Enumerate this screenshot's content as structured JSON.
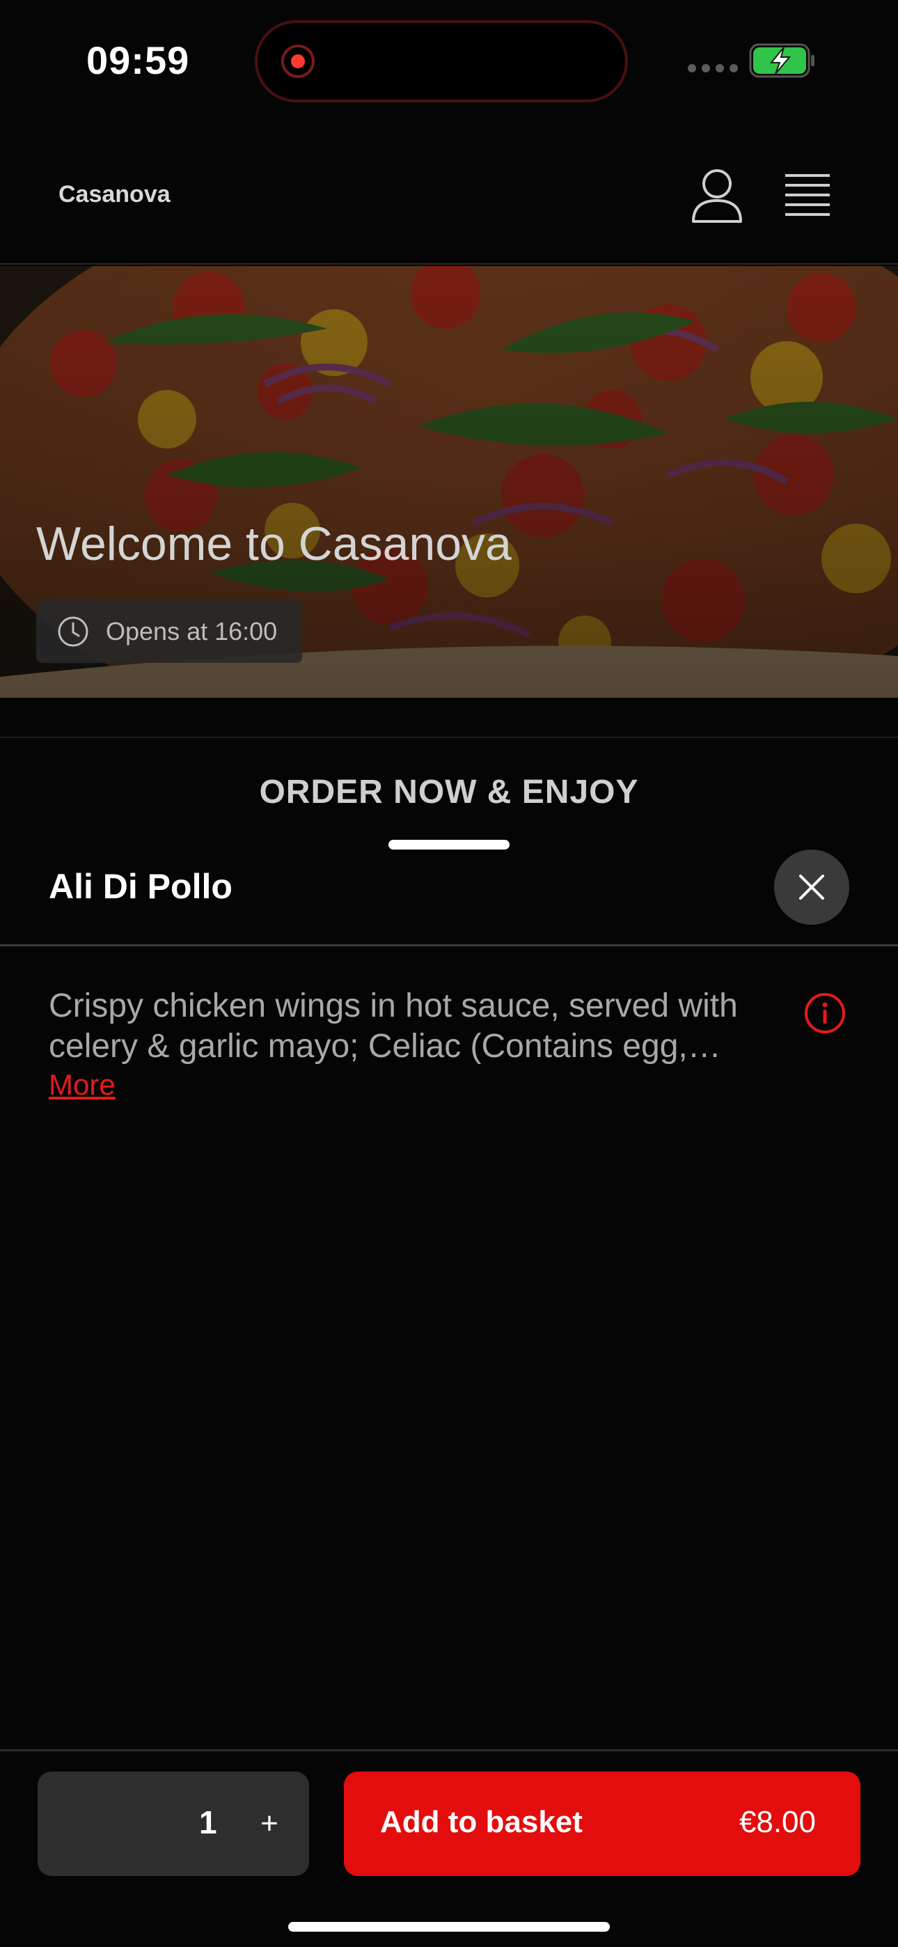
{
  "status_bar": {
    "time": "09:59"
  },
  "header": {
    "brand": "Casanova",
    "account_icon": "person-outline-icon",
    "menu_icon": "hamburger-menu-icon"
  },
  "hero": {
    "title": "Welcome to Casanova",
    "opening_text": "Opens at 16:00",
    "clock_icon": "clock-icon"
  },
  "tabs": {
    "active_label": "ORDER NOW & ENJOY"
  },
  "product": {
    "name": "Ali Di Pollo",
    "description": "Crispy chicken wings in hot sauce, served with celery & garlic mayo; Celiac (Contains egg, mustard)",
    "more_label": "More",
    "close_icon": "close-icon",
    "info_icon": "info-icon"
  },
  "footer": {
    "quantity": "1",
    "plus_label": "+",
    "add_label": "Add to basket",
    "price": "€8.00"
  },
  "colors": {
    "background": "#050505",
    "accent": "#e30d0d",
    "link": "#e61a1a"
  }
}
